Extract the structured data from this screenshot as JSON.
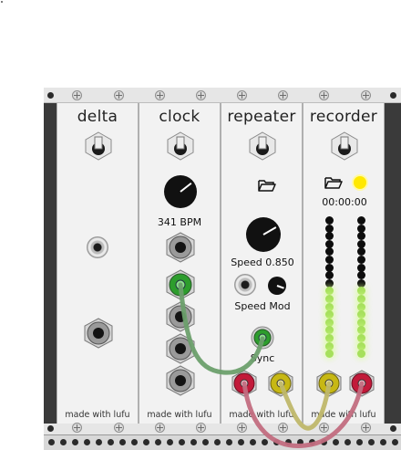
{
  "modules": {
    "delta": {
      "title": "delta",
      "footer": "made with lufu"
    },
    "clock": {
      "title": "clock",
      "footer": "made with lufu",
      "bpm_display": "341 BPM"
    },
    "repeater": {
      "title": "repeater",
      "footer": "made with lufu",
      "speed_display": "Speed 0.850",
      "speed_mod_label": "Speed Mod",
      "sync_label": "Sync"
    },
    "recorder": {
      "title": "recorder",
      "footer": "made with lufu",
      "time_display": "00:00:00"
    }
  },
  "icons": [
    "screw-icon",
    "toggle-switch-icon",
    "folder-open-icon",
    "knob-icon",
    "jack-icon",
    "led-icon"
  ],
  "colors": {
    "cable_green": "#6b9f6b",
    "cable_yellow": "#bfb76a",
    "cable_pink": "#c26d7f",
    "jack_green": "#2d9d2d",
    "jack_yellow": "#c7b814",
    "jack_red": "#c21a3a",
    "led_on": "#ffe800",
    "meter_green": "#a6e05c",
    "meter_black": "#0d0d0d"
  },
  "meters": {
    "left_lit": 9,
    "right_lit": 9,
    "segments": 18
  }
}
